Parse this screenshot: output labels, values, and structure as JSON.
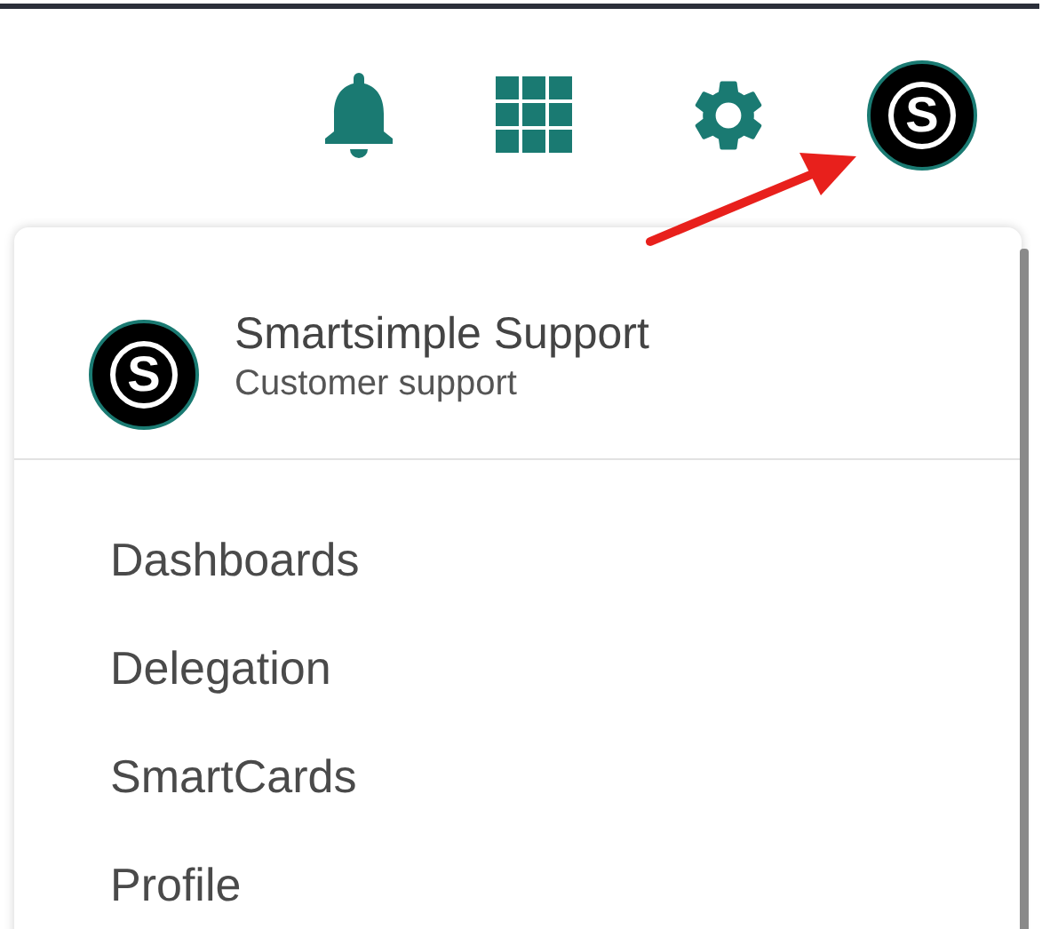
{
  "toolbar": {
    "avatar_letter": "S"
  },
  "profile_menu": {
    "user_name": "Smartsimple Support",
    "user_role": "Customer support",
    "avatar_letter": "S",
    "items": [
      {
        "label": "Dashboards"
      },
      {
        "label": "Delegation"
      },
      {
        "label": "SmartCards"
      },
      {
        "label": "Profile"
      }
    ]
  }
}
